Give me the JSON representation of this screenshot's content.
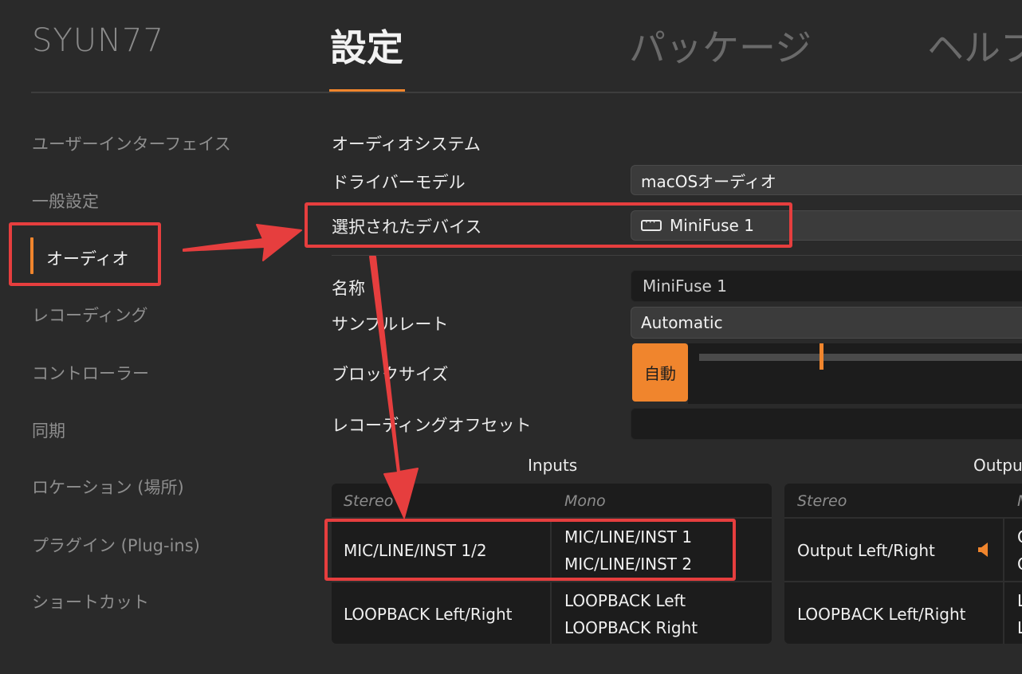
{
  "app": {
    "brand": "SYUN77"
  },
  "tabs": [
    {
      "label": "設定",
      "active": true
    },
    {
      "label": "パッケージ",
      "active": false
    },
    {
      "label": "ヘルプ",
      "active": false
    }
  ],
  "sidebar": {
    "items": [
      {
        "label": "ユーザーインターフェイス"
      },
      {
        "label": "一般設定"
      },
      {
        "label": "オーディオ",
        "active": true
      },
      {
        "label": "レコーディング"
      },
      {
        "label": "コントローラー"
      },
      {
        "label": "同期"
      },
      {
        "label": "ロケーション (場所)"
      },
      {
        "label": "プラグイン (Plug-ins)"
      },
      {
        "label": "ショートカット"
      }
    ]
  },
  "audio": {
    "system_label": "オーディオシステム",
    "driver_label": "ドライバーモデル",
    "driver_value": "macOSオーディオ",
    "device_label": "選択されたデバイス",
    "device_value": "MiniFuse 1",
    "name_label": "名称",
    "name_value": "MiniFuse 1",
    "samplerate_label": "サンプルレート",
    "samplerate_value": "Automatic",
    "blocksize_label": "ブロックサイズ",
    "blocksize_auto": "自動",
    "offset_label": "レコーディングオフセット"
  },
  "inputs": {
    "title": "Inputs",
    "col_stereo": "Stereo",
    "col_mono": "Mono",
    "rows": [
      {
        "stereo": "MIC/LINE/INST 1/2",
        "mono": [
          "MIC/LINE/INST 1",
          "MIC/LINE/INST 2"
        ]
      },
      {
        "stereo": "LOOPBACK Left/Right",
        "mono": [
          "LOOPBACK Left",
          "LOOPBACK Right"
        ]
      }
    ]
  },
  "outputs": {
    "title": "Outputs",
    "col_stereo": "Stereo",
    "col_mono": "Mono",
    "rows": [
      {
        "stereo": "Output Left/Right",
        "mono": [
          "Output Left",
          "Output Right"
        ]
      },
      {
        "stereo": "LOOPBACK Left/Right",
        "mono": [
          "LOOPBACK Left",
          "LOOPBACK Right"
        ]
      }
    ]
  },
  "colors": {
    "accent": "#f0852d",
    "annotation": "#e63e3e",
    "background": "#2a2a2a"
  },
  "icons": {
    "device": "audio-interface-icon",
    "speaker": "speaker-icon"
  }
}
